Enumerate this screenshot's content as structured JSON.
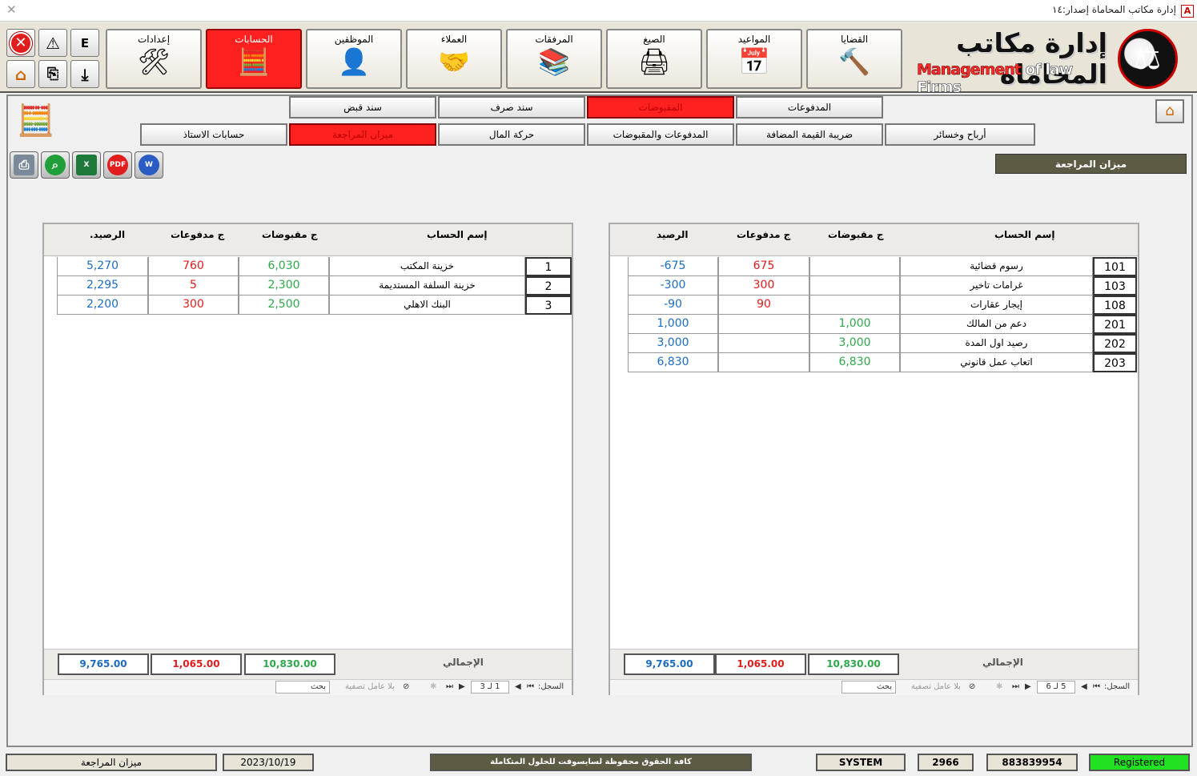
{
  "window": {
    "title": "إدارة مكاتب المحاماة إصدار:١٤",
    "app_icon": "A"
  },
  "small_buttons": {
    "exit": "exit-icon",
    "warning": "warning-icon",
    "lang": "E",
    "home": "home-icon",
    "copy": "copy-icon",
    "download": "download-icon"
  },
  "main_menu": [
    {
      "label": "إعدادات",
      "icon": "🛠"
    },
    {
      "label": "الحسابات",
      "icon": "🧮",
      "active": true
    },
    {
      "label": "الموظفين",
      "icon": "👤"
    },
    {
      "label": "العملاء",
      "icon": "🤝"
    },
    {
      "label": "المرفقات",
      "icon": "📚"
    },
    {
      "label": "الصيغ",
      "icon": "🖨"
    },
    {
      "label": "المواعيد",
      "icon": "📅"
    },
    {
      "label": "القضايا",
      "icon": "🔨"
    }
  ],
  "logo": {
    "arabic": "إدارة مكاتب المحاماه",
    "en_red": "Management",
    "en_white": " of law Firms"
  },
  "sub_tabs_row1": [
    "سند قبض",
    "سند صرف",
    "المقبوضات",
    "المدفوعات"
  ],
  "sub_tabs_row2": [
    "حسابات الاستاذ",
    "ميزان المراجعة",
    "حركة المال",
    "المدفوعات والمقبوضات",
    "ضريبة القيمة المضافة",
    "أرباح وخسائر"
  ],
  "export_buttons": [
    "PRINT",
    "FIND",
    "X",
    "PDF",
    "W"
  ],
  "page_title": "ميزان المراجعة",
  "left_grid": {
    "headers": {
      "name": "إسم الحساب",
      "receipts": "ج مقبوضات",
      "payments": "ج مدفوعات",
      "balance": "الرصيد."
    },
    "rows": [
      {
        "id": "1",
        "name": "خزينة المكتب",
        "receipts": "6,030",
        "payments": "760",
        "balance": "5,270"
      },
      {
        "id": "2",
        "name": "خزينة السلفة المستديمة",
        "receipts": "2,300",
        "payments": "5",
        "balance": "2,295"
      },
      {
        "id": "3",
        "name": "البنك الاهلي",
        "receipts": "2,500",
        "payments": "300",
        "balance": "2,200"
      }
    ],
    "totals": {
      "label": "الإجمالي",
      "receipts": "10,830.00",
      "payments": "1,065.00",
      "balance": "9,765.00"
    },
    "nav": {
      "record_label": "السجل:",
      "record": "1 لـ 3",
      "filter": "بلا عامل تصفية",
      "search": "بحث"
    }
  },
  "right_grid": {
    "headers": {
      "name": "إسم الحساب",
      "receipts": "ج مقبوضات",
      "payments": "ج مدفوعات",
      "balance": "الرصيد"
    },
    "rows": [
      {
        "id": "101",
        "name": "رسوم قضائية",
        "receipts": "",
        "payments": "675",
        "balance": "-675"
      },
      {
        "id": "103",
        "name": "غرامات تاخير",
        "receipts": "",
        "payments": "300",
        "balance": "-300"
      },
      {
        "id": "108",
        "name": "إيجار عقارات",
        "receipts": "",
        "payments": "90",
        "balance": "-90"
      },
      {
        "id": "201",
        "name": "دعم من المالك",
        "receipts": "1,000",
        "payments": "",
        "balance": "1,000"
      },
      {
        "id": "202",
        "name": "رصيد اول المدة",
        "receipts": "3,000",
        "payments": "",
        "balance": "3,000"
      },
      {
        "id": "203",
        "name": "اتعاب عمل قانوني",
        "receipts": "6,830",
        "payments": "",
        "balance": "6,830"
      }
    ],
    "totals": {
      "label": "الإجمالي",
      "receipts": "10,830.00",
      "payments": "1,065.00",
      "balance": "9,765.00"
    },
    "nav": {
      "record_label": "السجل:",
      "record": "5 لـ 6",
      "filter": "بلا عامل تصفية",
      "search": "بحث"
    }
  },
  "status_bar": {
    "form": "ميزان المراجعة",
    "date": "2023/10/19",
    "copyright": "كافة الحقوق محفوظة لسايسوفت للحلول المتكاملة",
    "user": "SYSTEM",
    "code": "2966",
    "serial": "883839954",
    "registration": "Registered"
  }
}
